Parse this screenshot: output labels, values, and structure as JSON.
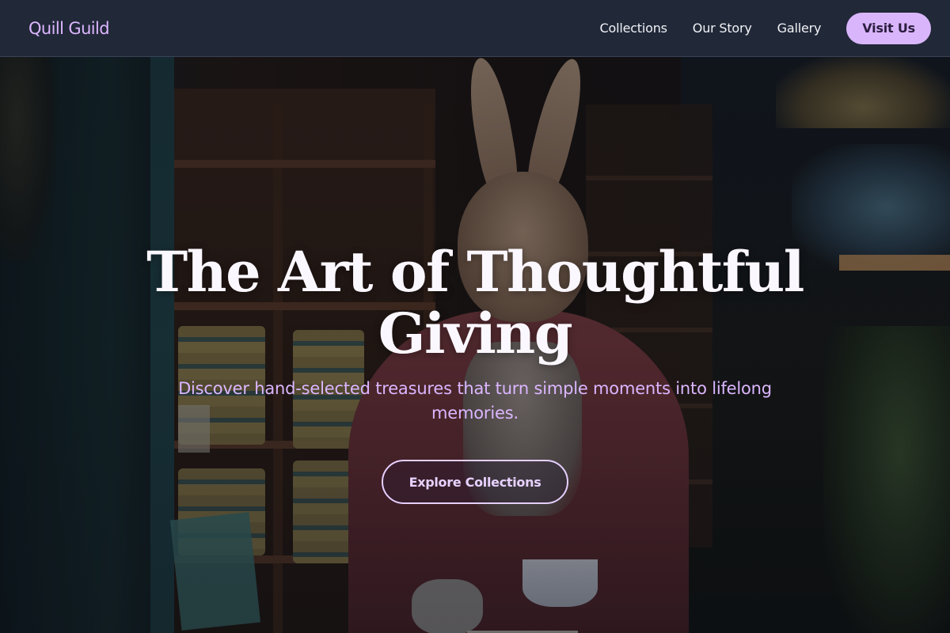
{
  "brand": {
    "name": "Quill Guild"
  },
  "nav": {
    "links": [
      {
        "label": "Collections"
      },
      {
        "label": "Our Story"
      },
      {
        "label": "Gallery"
      }
    ],
    "cta_label": "Visit Us"
  },
  "hero": {
    "title_line1": "The Art of Thoughtful",
    "title_line2": "Giving",
    "subtitle": "Discover hand-selected treasures that turn simple moments into lifelong memories.",
    "cta_label": "Explore Collections",
    "background": "photo of a gift shop with a rabbit figure in a red coat holding a teacup"
  },
  "colors": {
    "nav_bg": "#212838",
    "accent": "#d9b6fb",
    "brand_text": "#dcb6ff",
    "title_text": "#fbf7ff"
  }
}
